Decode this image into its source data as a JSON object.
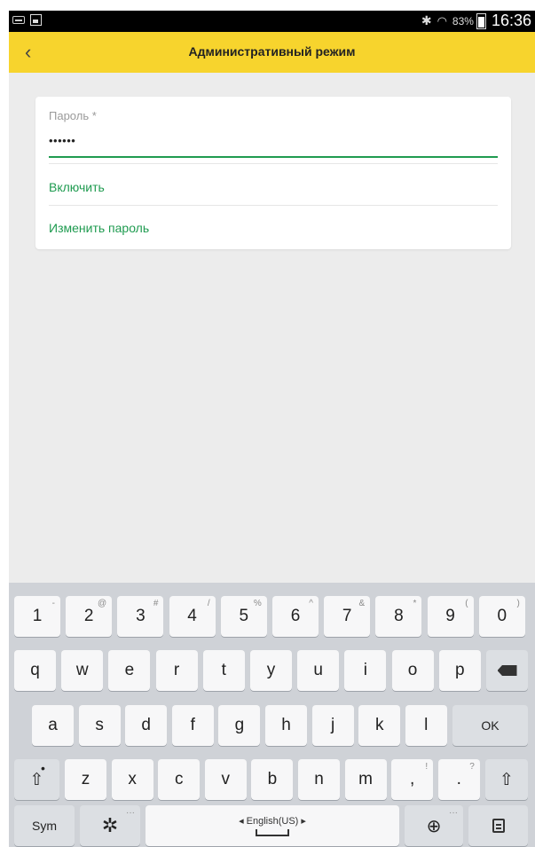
{
  "status_bar": {
    "battery_percent": "83%",
    "clock": "16:36",
    "left_icons": [
      "keyboard-icon",
      "image-icon"
    ],
    "right_icons": [
      "bluetooth-icon",
      "wifi-icon",
      "battery-icon"
    ]
  },
  "app_bar": {
    "back_icon": "‹",
    "title": "Административный режим",
    "background": "#f7d42d"
  },
  "card": {
    "password_label": "Пароль *",
    "password_value": "••••••",
    "enable_label": "Включить",
    "change_password_label": "Изменить пароль",
    "accent_color": "#1f9b50"
  },
  "keyboard": {
    "row1": [
      {
        "k": "1",
        "h": "-"
      },
      {
        "k": "2",
        "h": "@"
      },
      {
        "k": "3",
        "h": "#"
      },
      {
        "k": "4",
        "h": "/"
      },
      {
        "k": "5",
        "h": "%"
      },
      {
        "k": "6",
        "h": "^"
      },
      {
        "k": "7",
        "h": "&"
      },
      {
        "k": "8",
        "h": "*"
      },
      {
        "k": "9",
        "h": "("
      },
      {
        "k": "0",
        "h": ")"
      }
    ],
    "row2": [
      "q",
      "w",
      "e",
      "r",
      "t",
      "y",
      "u",
      "i",
      "o",
      "p"
    ],
    "row3": [
      "a",
      "s",
      "d",
      "f",
      "g",
      "h",
      "j",
      "k",
      "l"
    ],
    "ok_label": "OK",
    "row4": [
      {
        "k": "z",
        "h": ""
      },
      {
        "k": "x",
        "h": ""
      },
      {
        "k": "c",
        "h": ""
      },
      {
        "k": "v",
        "h": ""
      },
      {
        "k": "b",
        "h": ""
      },
      {
        "k": "n",
        "h": ""
      },
      {
        "k": "m",
        "h": ""
      },
      {
        "k": ",",
        "h": "!"
      },
      {
        "k": ".",
        "h": "?"
      }
    ],
    "sym_label": "Sym",
    "language_label": "◂ English(US) ▸"
  }
}
